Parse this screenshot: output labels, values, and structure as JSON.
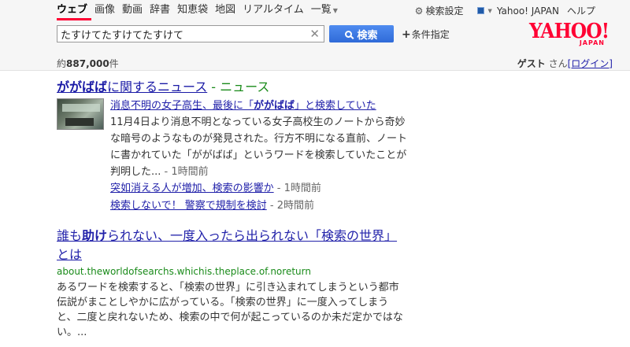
{
  "nav": {
    "items": [
      "ウェブ",
      "画像",
      "動画",
      "辞書",
      "知恵袋",
      "地図",
      "リアルタイム",
      "一覧"
    ]
  },
  "top_links": {
    "settings": "検索設定",
    "yahoo_japan": "Yahoo! JAPAN",
    "help": "ヘルプ"
  },
  "search": {
    "query": "たすけてたすけてたすけて",
    "button_label": "検索",
    "conditions_label": "条件指定"
  },
  "logo": {
    "text": "YAHOO!",
    "sub": "JAPAN"
  },
  "results_info": {
    "prefix": "約",
    "count": "887,000",
    "suffix": "件"
  },
  "user": {
    "guest": "ゲスト",
    "san": "さん",
    "login": "[ログイン]"
  },
  "news": {
    "heading_kw": "ががばば",
    "heading_rest": "に関するニュース",
    "heading_tag": " - ニュース",
    "title_pre": "消息不明の女子高生、最後に「",
    "title_kw": "ががばば",
    "title_post": "」と検索していた",
    "snippet": "11月4日より消息不明となっている女子高校生のノートから奇妙な暗号のようなものが発見された。行方不明になる直前、ノートに書かれていた「ががばば」というワードを検索していたことが判明した...",
    "snippet_time": " - 1時間前",
    "sub_items": [
      {
        "title": "突如消える人が増加、検索の影響か",
        "time": " - 1時間前"
      },
      {
        "title": "検索しないで！ 警察で規制を検討",
        "time": " - 2時間前"
      }
    ]
  },
  "result2": {
    "title_pre": "誰も",
    "title_kw": "助け",
    "title_post": "られない、一度入ったら出られない「検索の世界」とは",
    "url": "about.theworldofsearchs.whichis.theplace.of.noreturn",
    "snippet": "あるワードを検索すると、「検索の世界」に引き込まれてしまうという都市伝説がまことしやかに広がっている。「検索の世界」に一度入ってしまうと、二度と戻れないため、検索の中で何が起こっているのか未だ定かではない。..."
  },
  "colors": {
    "accent": "#ff0033",
    "search_button": "#2f6ad8",
    "link": "#1a0dab",
    "url_green": "#1a8b1a"
  }
}
